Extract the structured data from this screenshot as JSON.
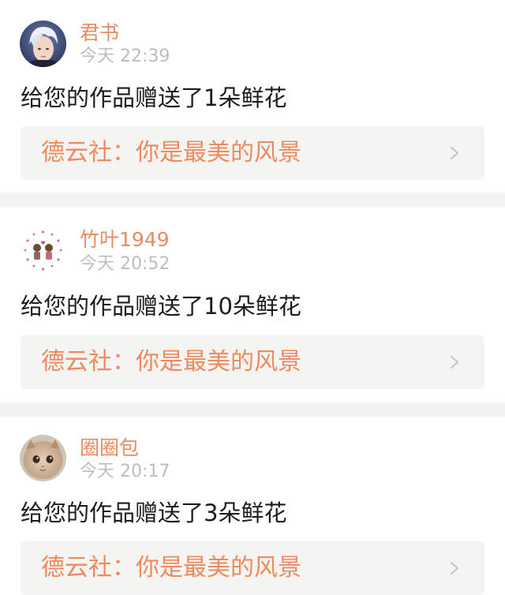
{
  "notifications": [
    {
      "username": "君书",
      "time": "今天 22:39",
      "message": "给您的作品赠送了1朵鲜花",
      "work_title": "德云社：你是最美的风景",
      "avatar_icon": "avatar-silver-hair-person"
    },
    {
      "username": "竹叶1949",
      "time": "今天 20:52",
      "message": "给您的作品赠送了10朵鲜花",
      "work_title": "德云社：你是最美的风景",
      "avatar_icon": "avatar-cartoon-couple"
    },
    {
      "username": "圈圈包",
      "time": "今天 20:17",
      "message": "给您的作品赠送了3朵鲜花",
      "work_title": "德云社：你是最美的风景",
      "avatar_icon": "avatar-kitten"
    }
  ],
  "colors": {
    "username": "#e88b5e",
    "work_title": "#ee8a5d",
    "time": "#bdbdbd",
    "message": "#1c1c1c",
    "link_bg": "#f4f4f2",
    "divider": "#f3f3f3"
  },
  "icons": {
    "chevron": "chevron-right-icon"
  }
}
